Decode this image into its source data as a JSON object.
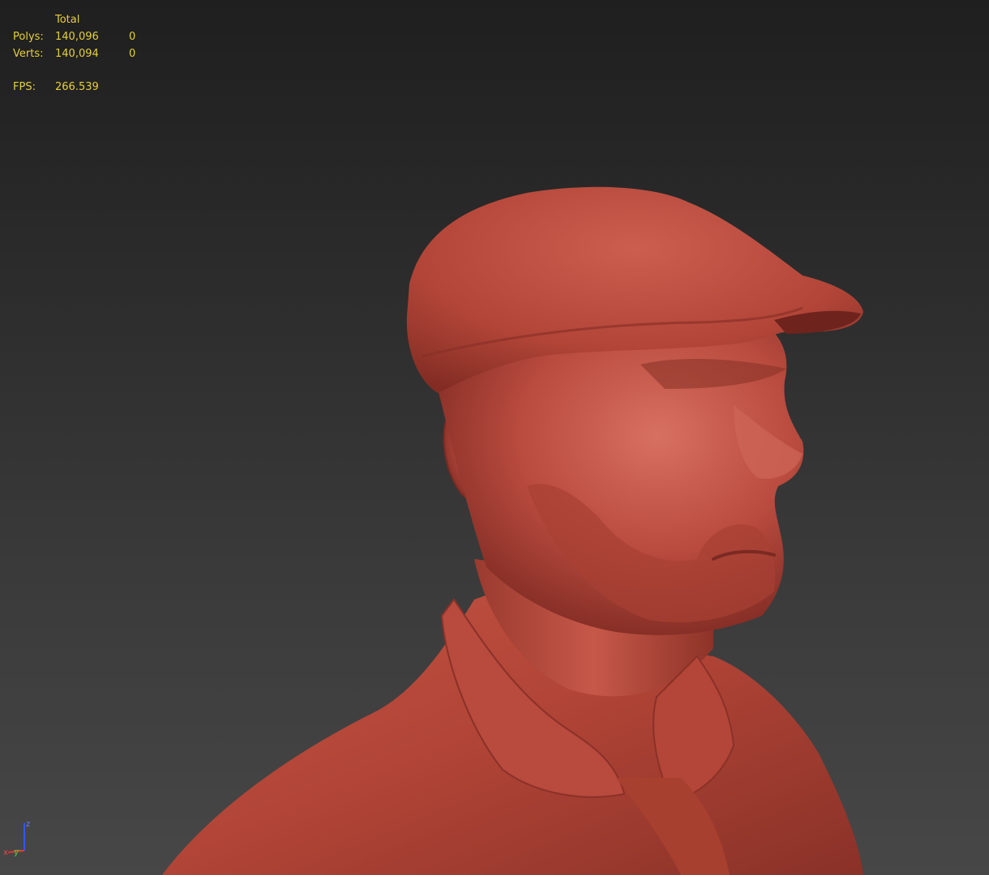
{
  "stats": {
    "header": "Total",
    "polys_label": "Polys:",
    "polys_total": "140,096",
    "polys_selected": "0",
    "verts_label": "Verts:",
    "verts_total": "140,094",
    "verts_selected": "0",
    "fps_label": "FPS:",
    "fps_value": "266.539"
  },
  "axis_gizmo": {
    "z_label": "z",
    "y_label": "y",
    "x_label": "x"
  },
  "colors": {
    "stats_text": "#e6cf3c",
    "model_base": "#b84a3e",
    "model_shadow": "#7e2a22",
    "model_highlight": "#d46a5a"
  },
  "model": {
    "description_icon": "sculpt-bust-model"
  }
}
